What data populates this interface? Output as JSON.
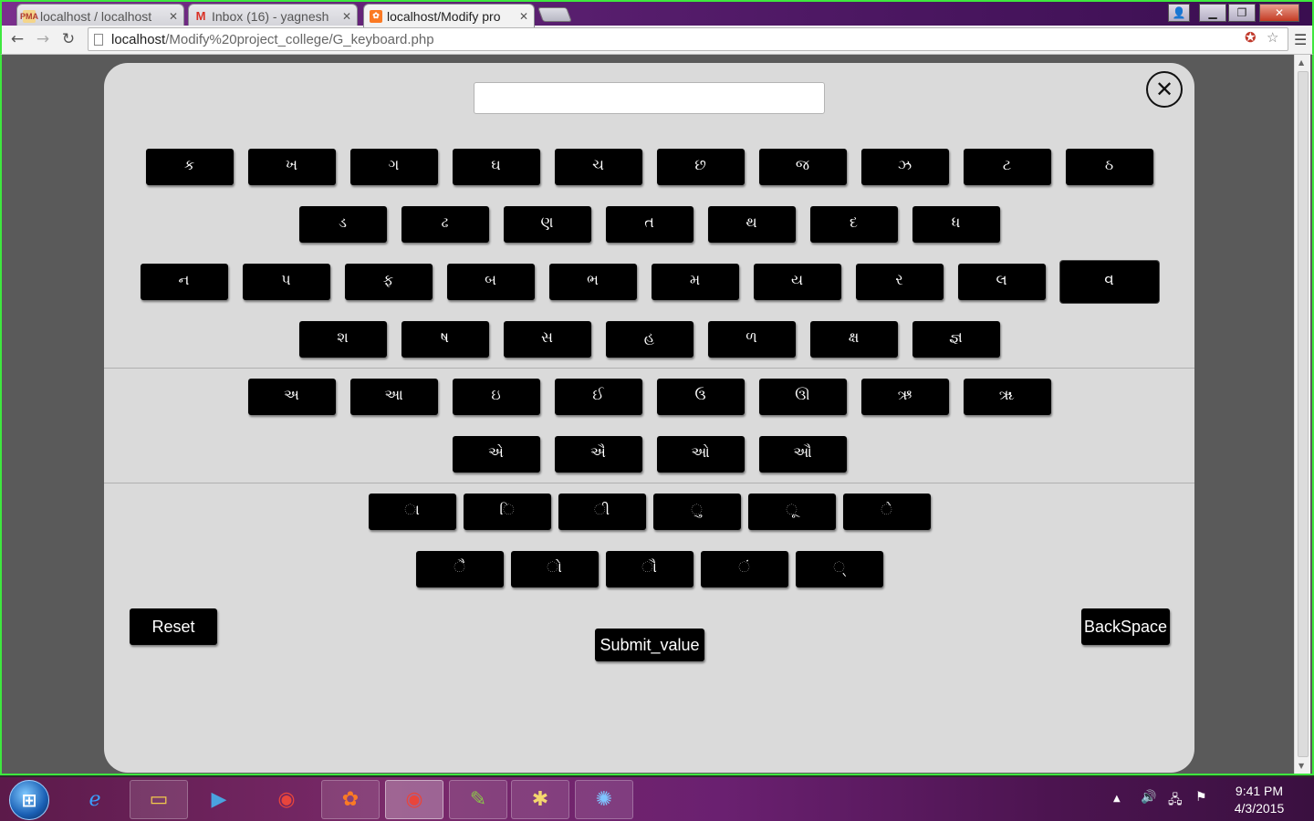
{
  "browser": {
    "tabs": [
      {
        "title": "localhost / localhost",
        "favicon": "PMA",
        "active": false
      },
      {
        "title": "Inbox (16) - yagnesh",
        "favicon": "M",
        "active": false
      },
      {
        "title": "localhost/Modify pro",
        "favicon": "xampp",
        "active": true
      }
    ],
    "url_host": "localhost",
    "url_path": "/Modify%20project_college/G_keyboard.php",
    "window_controls": [
      "user-icon",
      "minimize-icon",
      "maximize-icon",
      "close-icon"
    ]
  },
  "keyboard": {
    "input_value": "",
    "close_glyph": "✕",
    "consonant_rows": [
      [
        "ક",
        "ખ",
        "ગ",
        "ઘ",
        "ચ",
        "છ",
        "જ",
        "ઝ",
        "ટ",
        "ઠ"
      ],
      [
        "ડ",
        "ઢ",
        "ણ",
        "ત",
        "થ",
        "દ",
        "ધ"
      ],
      [
        "ન",
        "પ",
        "ફ",
        "બ",
        "ભ",
        "મ",
        "ય",
        "ર",
        "લ",
        "વ"
      ],
      [
        "શ",
        "ષ",
        "સ",
        "હ",
        "ળ",
        "ક્ષ",
        "જ્ઞ"
      ]
    ],
    "vowel_rows": [
      [
        "અ",
        "આ",
        "ઇ",
        "ઈ",
        "ઉ",
        "ઊ",
        "ઋ",
        "ૠ"
      ],
      [
        "એ",
        "ઐ",
        "ઓ",
        "ઔ"
      ]
    ],
    "matra_rows": [
      [
        "ા",
        "િ",
        "ી",
        "ુ",
        "ૂ",
        "ે"
      ],
      [
        "ૈ",
        "ો",
        "ૌ",
        "ં",
        "્"
      ]
    ],
    "reset_label": "Reset",
    "submit_label": "Submit_value",
    "backspace_label": "BackSpace"
  },
  "taskbar": {
    "apps": [
      "internet-explorer-icon",
      "file-explorer-icon",
      "media-player-icon",
      "chrome-icon",
      "xampp-icon",
      "chrome-icon",
      "notepad-icon",
      "paint-icon",
      "safari-icon"
    ],
    "time": "9:41 PM",
    "date": "4/3/2015"
  },
  "colors": {
    "window_border": "#3ee83e",
    "panel_background": "#dadada",
    "key_background": "#000000",
    "key_text": "#ffffff"
  }
}
